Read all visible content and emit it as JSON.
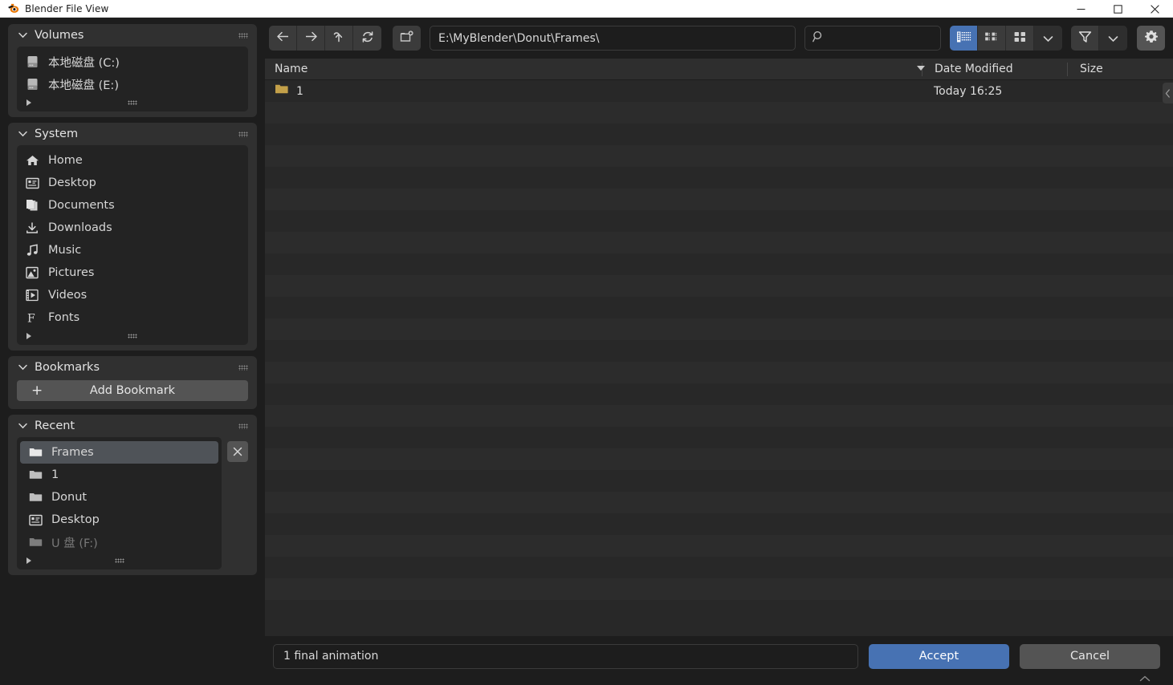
{
  "window": {
    "title": "Blender File View",
    "logo_icon": "blender-logo-icon",
    "minimize_label": "—",
    "maximize_label": "□",
    "close_label": "✕"
  },
  "sidebar": {
    "panels": [
      {
        "title": "Volumes",
        "grip_icon": "drag-grip-icon",
        "items": [
          {
            "label": "本地磁盘 (C:)",
            "icon": "disk-drive-icon",
            "dim": false,
            "selected": false
          },
          {
            "label": "本地磁盘 (E:)",
            "icon": "disk-drive-icon",
            "dim": false,
            "selected": false
          }
        ],
        "has_more_row": true
      },
      {
        "title": "System",
        "grip_icon": "drag-grip-icon",
        "items": [
          {
            "label": "Home",
            "icon": "home-icon",
            "dim": false,
            "selected": false
          },
          {
            "label": "Desktop",
            "icon": "desktop-icon",
            "dim": false,
            "selected": false
          },
          {
            "label": "Documents",
            "icon": "documents-icon",
            "dim": false,
            "selected": false
          },
          {
            "label": "Downloads",
            "icon": "download-icon",
            "dim": false,
            "selected": false
          },
          {
            "label": "Music",
            "icon": "music-note-icon",
            "dim": false,
            "selected": false
          },
          {
            "label": "Pictures",
            "icon": "picture-icon",
            "dim": false,
            "selected": false
          },
          {
            "label": "Videos",
            "icon": "film-icon",
            "dim": false,
            "selected": false
          },
          {
            "label": "Fonts",
            "icon": "font-icon",
            "dim": false,
            "selected": false
          }
        ],
        "has_more_row": true
      },
      {
        "title": "Bookmarks",
        "grip_icon": "drag-grip-icon",
        "add_bookmark_label": "Add Bookmark",
        "items": [],
        "has_more_row": false
      },
      {
        "title": "Recent",
        "grip_icon": "drag-grip-icon",
        "clear_icon": "close-x-icon",
        "items": [
          {
            "label": "Frames",
            "icon": "folder-icon",
            "dim": false,
            "selected": true
          },
          {
            "label": "1",
            "icon": "folder-icon",
            "dim": false,
            "selected": false
          },
          {
            "label": "Donut",
            "icon": "folder-icon",
            "dim": false,
            "selected": false
          },
          {
            "label": "Desktop",
            "icon": "desktop-icon",
            "dim": false,
            "selected": false
          },
          {
            "label": "U 盘 (F:)",
            "icon": "folder-icon",
            "dim": true,
            "selected": false
          }
        ],
        "has_more_row": true
      }
    ]
  },
  "toolbar": {
    "back_icon": "arrow-left-icon",
    "forward_icon": "arrow-right-icon",
    "up_icon": "arrow-up-parent-icon",
    "refresh_icon": "refresh-icon",
    "new_folder_icon": "new-folder-icon",
    "path_value": "E:\\MyBlender\\Donut\\Frames\\",
    "search_icon": "search-icon",
    "search_value": "",
    "search_placeholder": "",
    "display_modes": [
      {
        "name": "vertical-list",
        "icon": "list-view-icon",
        "active": true
      },
      {
        "name": "horizontal-list",
        "icon": "detail-view-icon",
        "active": false
      },
      {
        "name": "thumbnails",
        "icon": "thumbnail-view-icon",
        "active": false
      }
    ],
    "display_dropdown_icon": "chevron-down-icon",
    "filter_icon": "filter-funnel-icon",
    "filter_dropdown_icon": "chevron-down-icon",
    "settings_icon": "gear-icon"
  },
  "filelist": {
    "columns": [
      {
        "key": "name",
        "label": "Name",
        "sorted": true,
        "sort_icon": "sort-desc-icon"
      },
      {
        "key": "date",
        "label": "Date Modified"
      },
      {
        "key": "size",
        "label": "Size"
      }
    ],
    "rows": [
      {
        "name": "1",
        "icon": "folder-icon-gold",
        "date": "Today 16:25",
        "size": ""
      }
    ],
    "empty_row_count": 24,
    "side_tab_icon": "chevron-left-icon"
  },
  "bottombar": {
    "filename_value": "1 final animation",
    "filename_placeholder": "",
    "accept_label": "Accept",
    "cancel_label": "Cancel",
    "resize_icon": "chevron-up-icon"
  },
  "colors": {
    "accent_blue": "#4772b3",
    "panel_bg": "#303030",
    "list_bg": "#232323",
    "main_bg": "#1d1d1d",
    "file_area_bg": "#282828",
    "folder_gold": "#c3a049",
    "selected_row": "#4f5358",
    "titlebar_bg": "#ffffff"
  }
}
